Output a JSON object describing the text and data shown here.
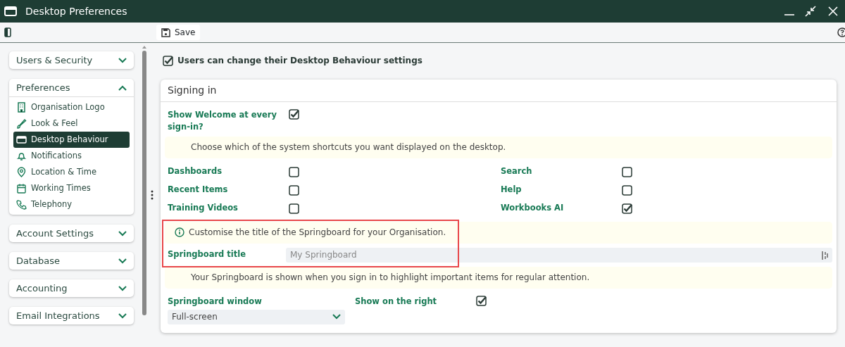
{
  "window": {
    "title": "Desktop Preferences"
  },
  "toolbar": {
    "save": "Save"
  },
  "sidebar": {
    "sections": [
      {
        "label": "Users & Security",
        "expanded": false
      },
      {
        "label": "Preferences",
        "expanded": true,
        "items": [
          {
            "label": "Organisation Logo",
            "selected": false
          },
          {
            "label": "Look & Feel",
            "selected": false
          },
          {
            "label": "Desktop Behaviour",
            "selected": true
          },
          {
            "label": "Notifications",
            "selected": false
          },
          {
            "label": "Location & Time",
            "selected": false
          },
          {
            "label": "Working Times",
            "selected": false
          },
          {
            "label": "Telephony",
            "selected": false
          }
        ]
      },
      {
        "label": "Account Settings",
        "expanded": false
      },
      {
        "label": "Database",
        "expanded": false
      },
      {
        "label": "Accounting",
        "expanded": false
      },
      {
        "label": "Email Integrations",
        "expanded": false
      }
    ]
  },
  "users_can_change": {
    "label": "Users can change their Desktop Behaviour settings",
    "checked": true
  },
  "panel": {
    "title": "Signing in",
    "show_welcome": {
      "label": "Show Welcome at every sign-in?",
      "checked": true
    },
    "shortcuts_note": "Choose which of the system shortcuts you want displayed on the desktop.",
    "shortcuts": [
      {
        "label": "Dashboards",
        "checked": false
      },
      {
        "label": "Search",
        "checked": false
      },
      {
        "label": "Recent Items",
        "checked": false
      },
      {
        "label": "Help",
        "checked": false
      },
      {
        "label": "Training Videos",
        "checked": false
      },
      {
        "label": "Workbooks AI",
        "checked": true
      }
    ],
    "springboard_title": {
      "note": "Customise the title of the Springboard for your Organisation.",
      "label": "Springboard title",
      "placeholder": "My Springboard",
      "highlighted": true
    },
    "springboard_note": "Your Springboard is shown when you sign in to highlight important items for regular attention.",
    "springboard_window": {
      "label": "Springboard window",
      "value": "Full-screen"
    },
    "show_on_right": {
      "label": "Show on the right",
      "checked": true
    }
  }
}
